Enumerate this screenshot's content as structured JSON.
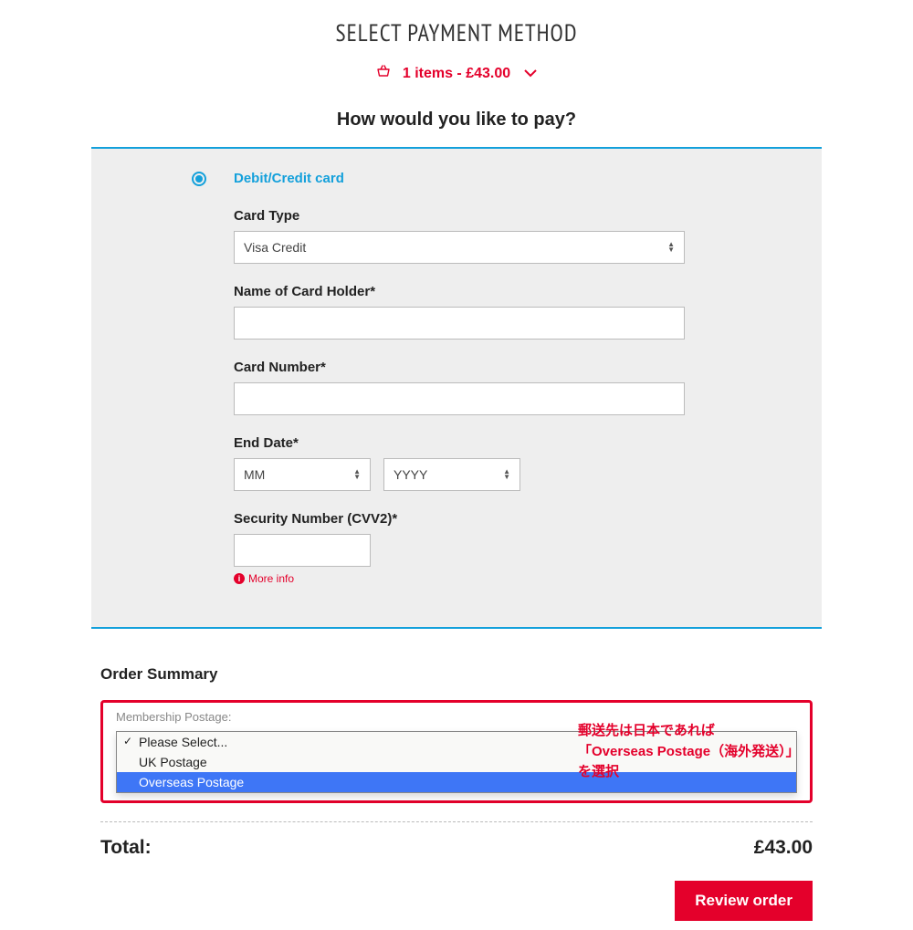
{
  "title": "SELECT PAYMENT METHOD",
  "basket_summary": "1 items - £43.00",
  "subheading": "How would you like to pay?",
  "payment_option_label": "Debit/Credit card",
  "form": {
    "card_type_label": "Card Type",
    "card_type_value": "Visa Credit",
    "holder_label": "Name of Card Holder*",
    "holder_value": "",
    "number_label": "Card Number*",
    "number_value": "",
    "end_date_label": "End Date*",
    "month_placeholder": "MM",
    "year_placeholder": "YYYY",
    "cvv_label": "Security Number (CVV2)*",
    "cvv_value": "",
    "more_info": "More info"
  },
  "order": {
    "heading": "Order Summary",
    "postage_label": "Membership Postage:",
    "options": {
      "placeholder": "Please Select...",
      "uk": "UK Postage",
      "overseas": "Overseas Postage"
    },
    "total_label": "Total:",
    "total_value": "£43.00",
    "review_button": "Review order"
  },
  "annotation": {
    "line1": "郵送先は日本であれば",
    "line2": "「Overseas Postage（海外発送）」",
    "line3": "を選択"
  }
}
